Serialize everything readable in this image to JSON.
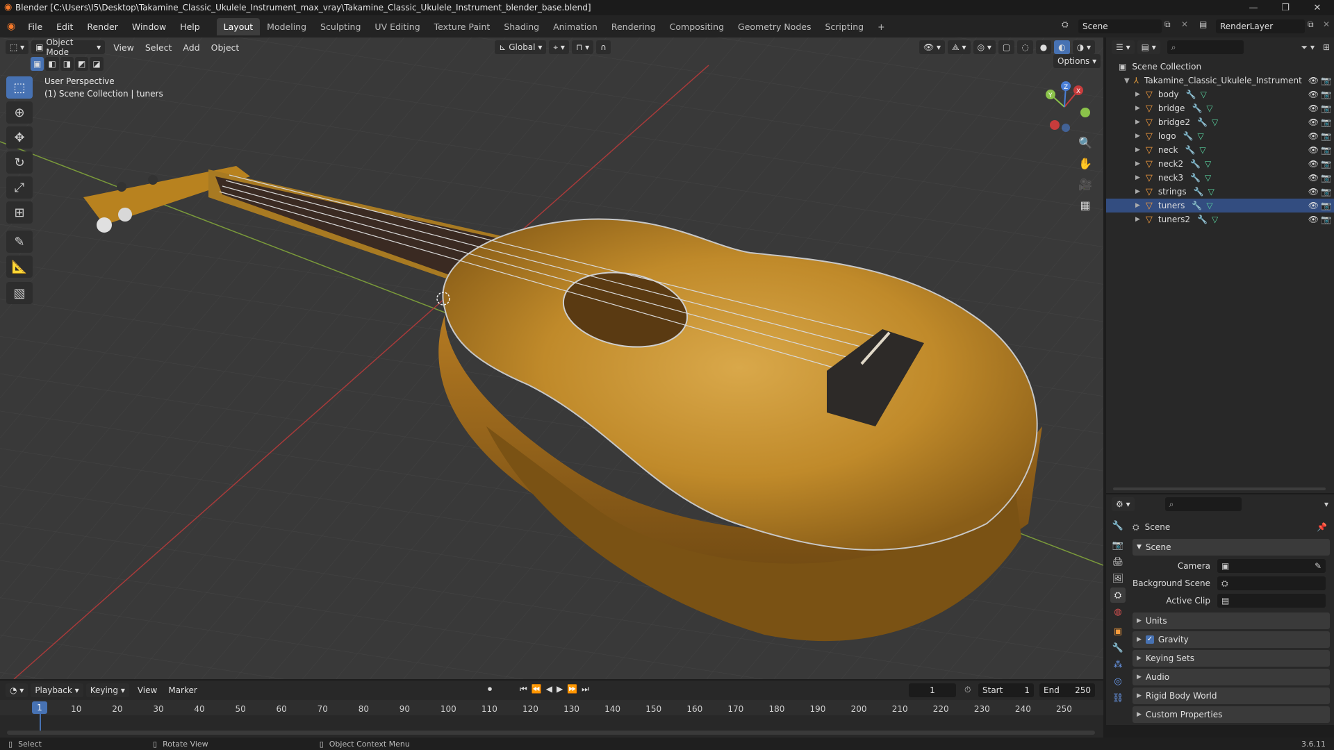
{
  "window": {
    "title": "Blender [C:\\Users\\I5\\Desktop\\Takamine_Classic_Ukulele_Instrument_max_vray\\Takamine_Classic_Ukulele_Instrument_blender_base.blend]",
    "version": "3.6.11"
  },
  "menu": {
    "items": [
      "File",
      "Edit",
      "Render",
      "Window",
      "Help"
    ]
  },
  "workspaces": {
    "tabs": [
      "Layout",
      "Modeling",
      "Sculpting",
      "UV Editing",
      "Texture Paint",
      "Shading",
      "Animation",
      "Rendering",
      "Compositing",
      "Geometry Nodes",
      "Scripting"
    ],
    "add": "+"
  },
  "scene_selector": {
    "scene": "Scene",
    "view_layer": "RenderLayer"
  },
  "viewport": {
    "mode": "Object Mode",
    "menus": [
      "View",
      "Select",
      "Add",
      "Object"
    ],
    "orientation": "Global",
    "options_label": "Options",
    "info_line1": "User Perspective",
    "info_line2": "(1) Scene Collection | tuners",
    "gizmo": {
      "x": "X",
      "y": "Y",
      "z": "Z"
    }
  },
  "outliner": {
    "root": "Scene Collection",
    "collection": "Takamine_Classic_Ukulele_Instrument",
    "objects": [
      "body",
      "bridge",
      "bridge2",
      "logo",
      "neck",
      "neck2",
      "neck3",
      "strings",
      "tuners",
      "tuners2"
    ]
  },
  "properties": {
    "context": "Scene",
    "panel_scene": "Scene",
    "fields": [
      {
        "label": "Camera",
        "value": ""
      },
      {
        "label": "Background Scene",
        "value": ""
      },
      {
        "label": "Active Clip",
        "value": ""
      }
    ],
    "panels": [
      "Units",
      "Gravity",
      "Keying Sets",
      "Audio",
      "Rigid Body World",
      "Custom Properties"
    ]
  },
  "timeline": {
    "menus": [
      "Playback",
      "Keying",
      "View",
      "Marker"
    ],
    "current_frame": "1",
    "start_label": "Start",
    "start": "1",
    "end_label": "End",
    "end": "250",
    "ticks": [
      "1",
      "10",
      "20",
      "30",
      "40",
      "50",
      "60",
      "70",
      "80",
      "90",
      "100",
      "110",
      "120",
      "130",
      "140",
      "150",
      "160",
      "170",
      "180",
      "190",
      "200",
      "210",
      "220",
      "230",
      "240",
      "250"
    ]
  },
  "statusbar": {
    "select": "Select",
    "rotate": "Rotate View",
    "context_menu": "Object Context Menu"
  },
  "colors": {
    "accent": "#4772b3",
    "object": "#f59b3d",
    "viewport_bg": "#393939",
    "x_axis": "#c83c3c",
    "y_axis": "#8bc34a"
  }
}
